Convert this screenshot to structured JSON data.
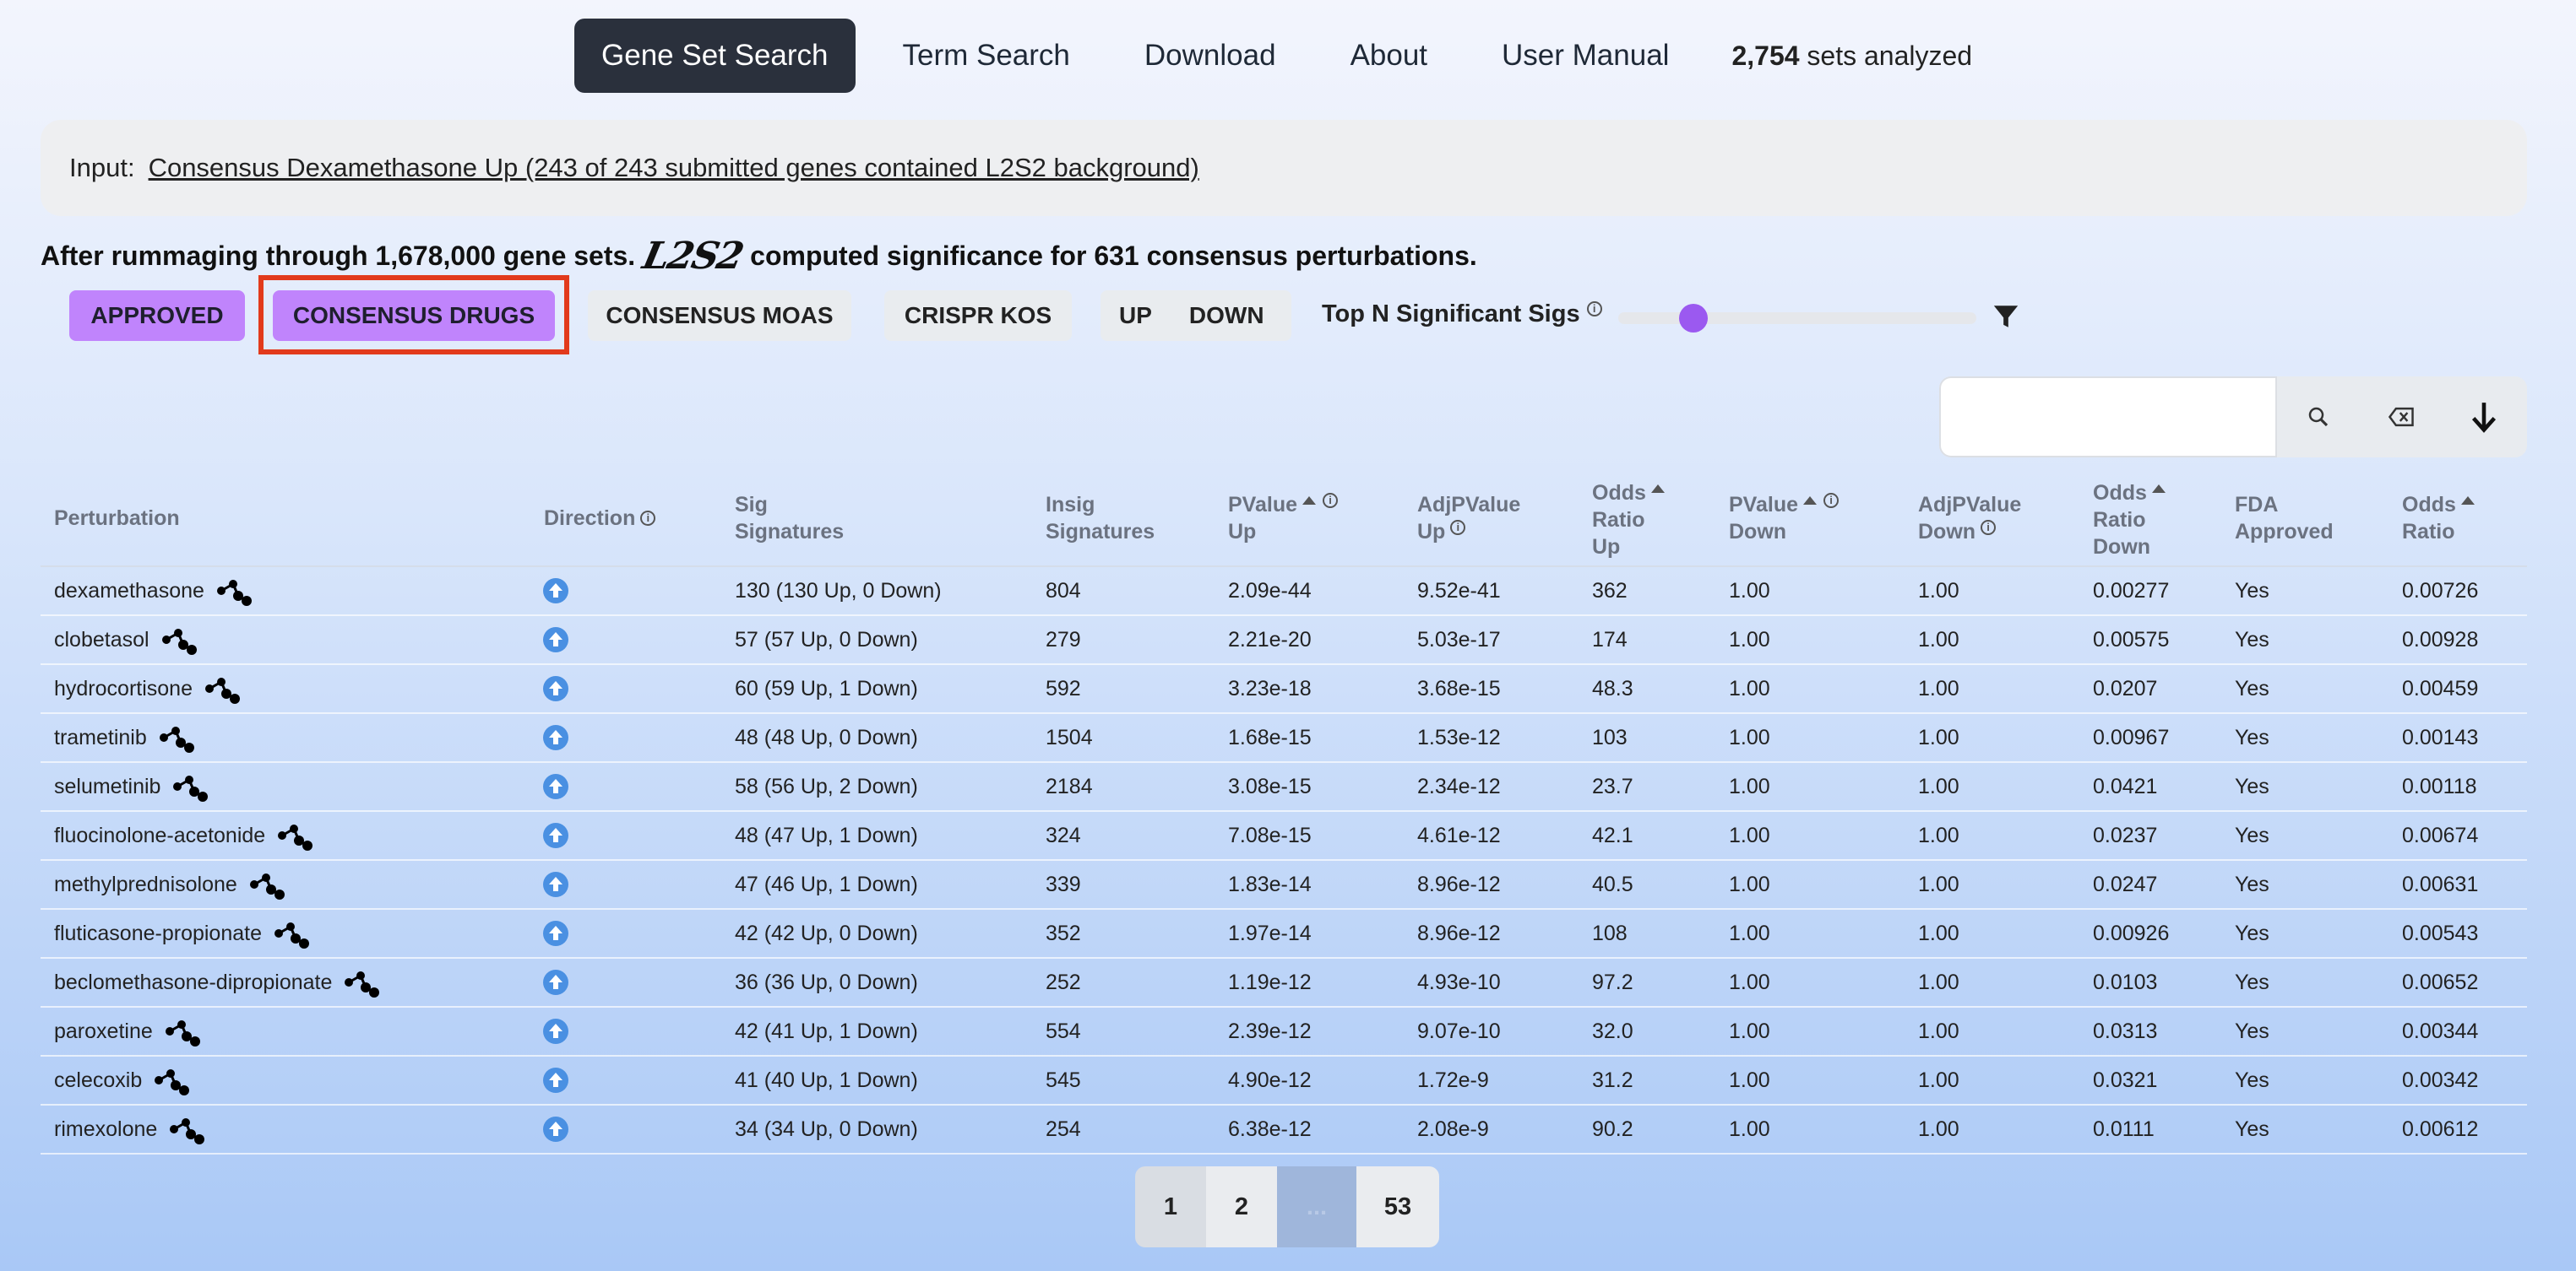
{
  "nav": {
    "items": [
      "Gene Set Search",
      "Term Search",
      "Download",
      "About",
      "User Manual"
    ],
    "active": "Gene Set Search",
    "sets_count": "2,754",
    "sets_label": "sets analyzed"
  },
  "input": {
    "label": "Input:",
    "link_text": "Consensus Dexamethasone Up (243 of 243 submitted genes contained L2S2 background)"
  },
  "summary": {
    "pre": "After rummaging through 1,678,000 gene sets.",
    "logo": "L2S2",
    "post": "computed significance for 631 consensus perturbations."
  },
  "filters": {
    "approved": "APPROVED",
    "consensus_drugs": "CONSENSUS DRUGS",
    "consensus_moas": "CONSENSUS MOAS",
    "crispr_kos": "CRISPR KOS",
    "up": "UP",
    "down": "DOWN",
    "top_n_label": "Top N Significant Sigs",
    "active": [
      "APPROVED",
      "CONSENSUS DRUGS"
    ],
    "slider_fraction": 0.18
  },
  "search": {
    "value": "",
    "placeholder": ""
  },
  "table": {
    "headers": {
      "perturbation": "Perturbation",
      "direction": "Direction",
      "sig_signatures": [
        "Sig",
        "Signatures"
      ],
      "insig_signatures": [
        "Insig",
        "Signatures"
      ],
      "pvalue_up": [
        "PValue",
        "Up"
      ],
      "adjp_up": [
        "AdjPValue",
        "Up"
      ],
      "odds_up": [
        "Odds",
        "Ratio",
        "Up"
      ],
      "pvalue_down": [
        "PValue",
        "Down"
      ],
      "adjp_down": [
        "AdjPValue",
        "Down"
      ],
      "odds_down": [
        "Odds",
        "Ratio",
        "Down"
      ],
      "fda": [
        "FDA",
        "Approved"
      ],
      "odds": [
        "Odds",
        "Ratio"
      ]
    },
    "rows": [
      {
        "name": "dexamethasone",
        "sig": "130 (130 Up, 0 Down)",
        "insig": "804",
        "p_up": "2.09e-44",
        "adj_up": "9.52e-41",
        "or_up": "362",
        "p_down": "1.00",
        "adj_down": "1.00",
        "or_down": "0.00277",
        "fda": "Yes",
        "or": "0.00726"
      },
      {
        "name": "clobetasol",
        "sig": "57 (57 Up, 0 Down)",
        "insig": "279",
        "p_up": "2.21e-20",
        "adj_up": "5.03e-17",
        "or_up": "174",
        "p_down": "1.00",
        "adj_down": "1.00",
        "or_down": "0.00575",
        "fda": "Yes",
        "or": "0.00928"
      },
      {
        "name": "hydrocortisone",
        "sig": "60 (59 Up, 1 Down)",
        "insig": "592",
        "p_up": "3.23e-18",
        "adj_up": "3.68e-15",
        "or_up": "48.3",
        "p_down": "1.00",
        "adj_down": "1.00",
        "or_down": "0.0207",
        "fda": "Yes",
        "or": "0.00459"
      },
      {
        "name": "trametinib",
        "sig": "48 (48 Up, 0 Down)",
        "insig": "1504",
        "p_up": "1.68e-15",
        "adj_up": "1.53e-12",
        "or_up": "103",
        "p_down": "1.00",
        "adj_down": "1.00",
        "or_down": "0.00967",
        "fda": "Yes",
        "or": "0.00143"
      },
      {
        "name": "selumetinib",
        "sig": "58 (56 Up, 2 Down)",
        "insig": "2184",
        "p_up": "3.08e-15",
        "adj_up": "2.34e-12",
        "or_up": "23.7",
        "p_down": "1.00",
        "adj_down": "1.00",
        "or_down": "0.0421",
        "fda": "Yes",
        "or": "0.00118"
      },
      {
        "name": "fluocinolone-acetonide",
        "sig": "48 (47 Up, 1 Down)",
        "insig": "324",
        "p_up": "7.08e-15",
        "adj_up": "4.61e-12",
        "or_up": "42.1",
        "p_down": "1.00",
        "adj_down": "1.00",
        "or_down": "0.0237",
        "fda": "Yes",
        "or": "0.00674"
      },
      {
        "name": "methylprednisolone",
        "sig": "47 (46 Up, 1 Down)",
        "insig": "339",
        "p_up": "1.83e-14",
        "adj_up": "8.96e-12",
        "or_up": "40.5",
        "p_down": "1.00",
        "adj_down": "1.00",
        "or_down": "0.0247",
        "fda": "Yes",
        "or": "0.00631"
      },
      {
        "name": "fluticasone-propionate",
        "sig": "42 (42 Up, 0 Down)",
        "insig": "352",
        "p_up": "1.97e-14",
        "adj_up": "8.96e-12",
        "or_up": "108",
        "p_down": "1.00",
        "adj_down": "1.00",
        "or_down": "0.00926",
        "fda": "Yes",
        "or": "0.00543"
      },
      {
        "name": "beclomethasone-dipropionate",
        "sig": "36 (36 Up, 0 Down)",
        "insig": "252",
        "p_up": "1.19e-12",
        "adj_up": "4.93e-10",
        "or_up": "97.2",
        "p_down": "1.00",
        "adj_down": "1.00",
        "or_down": "0.0103",
        "fda": "Yes",
        "or": "0.00652"
      },
      {
        "name": "paroxetine",
        "sig": "42 (41 Up, 1 Down)",
        "insig": "554",
        "p_up": "2.39e-12",
        "adj_up": "9.07e-10",
        "or_up": "32.0",
        "p_down": "1.00",
        "adj_down": "1.00",
        "or_down": "0.0313",
        "fda": "Yes",
        "or": "0.00344"
      },
      {
        "name": "celecoxib",
        "sig": "41 (40 Up, 1 Down)",
        "insig": "545",
        "p_up": "4.90e-12",
        "adj_up": "1.72e-9",
        "or_up": "31.2",
        "p_down": "1.00",
        "adj_down": "1.00",
        "or_down": "0.0321",
        "fda": "Yes",
        "or": "0.00342"
      },
      {
        "name": "rimexolone",
        "sig": "34 (34 Up, 0 Down)",
        "insig": "254",
        "p_up": "6.38e-12",
        "adj_up": "2.08e-9",
        "or_up": "90.2",
        "p_down": "1.00",
        "adj_down": "1.00",
        "or_down": "0.0111",
        "fda": "Yes",
        "or": "0.00612"
      }
    ]
  },
  "pagination": {
    "pages": [
      "1",
      "2",
      "...",
      "53"
    ],
    "current": "1"
  },
  "colors": {
    "accent_purple": "#c084fc",
    "nav_active": "#2a303c",
    "direction_up": "#4a90e2",
    "highlight_red": "#e23a1c"
  }
}
